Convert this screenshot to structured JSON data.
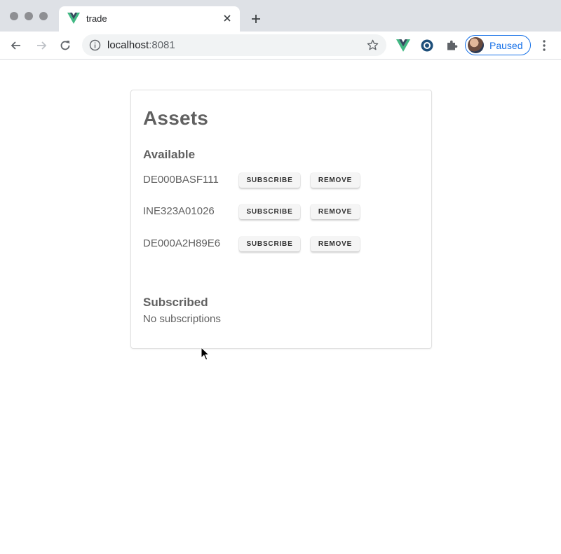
{
  "browser": {
    "tab_title": "trade",
    "url_host": "localhost",
    "url_port": ":8081",
    "profile_status": "Paused",
    "accent_color": "#1a73e8"
  },
  "page": {
    "title": "Assets",
    "available_heading": "Available",
    "subscribed_heading": "Subscribed",
    "empty_subscriptions": "No subscriptions",
    "assets": [
      {
        "id": "DE000BASF111",
        "subscribe_label": "SUBSCRIBE",
        "remove_label": "REMOVE"
      },
      {
        "id": "INE323A01026",
        "subscribe_label": "SUBSCRIBE",
        "remove_label": "REMOVE"
      },
      {
        "id": "DE000A2H89E6",
        "subscribe_label": "SUBSCRIBE",
        "remove_label": "REMOVE"
      }
    ]
  }
}
